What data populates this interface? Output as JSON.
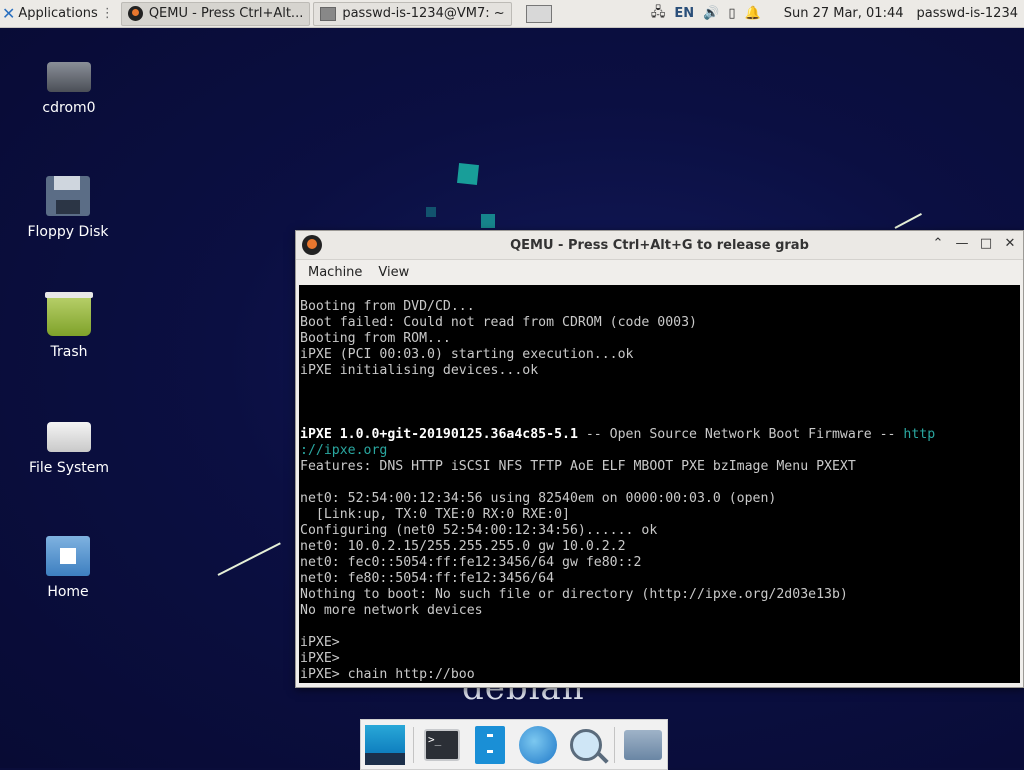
{
  "panel": {
    "applications_label": "Applications",
    "tasks": [
      {
        "label": "QEMU - Press Ctrl+Alt...",
        "icon": "qemu-icon"
      },
      {
        "label": "passwd-is-1234@VM7: ~",
        "icon": "terminal-icon"
      }
    ],
    "keyboard_layout": "EN",
    "clock": "Sun 27 Mar, 01:44",
    "user": "passwd-is-1234"
  },
  "desktop_icons": [
    {
      "label": "cdrom0",
      "icon": "optical-drive-icon"
    },
    {
      "label": "Floppy Disk",
      "icon": "floppy-disk-icon"
    },
    {
      "label": "Trash",
      "icon": "trash-icon"
    },
    {
      "label": "File System",
      "icon": "hard-drive-icon"
    },
    {
      "label": "Home",
      "icon": "home-folder-icon"
    }
  ],
  "wallpaper_text": "debian",
  "qemu": {
    "title": "QEMU - Press Ctrl+Alt+G to release grab",
    "menu": [
      "Machine",
      "View"
    ],
    "console": [
      "Booting from DVD/CD...",
      "Boot failed: Could not read from CDROM (code 0003)",
      "Booting from ROM...",
      "iPXE (PCI 00:03.0) starting execution...ok",
      "iPXE initialising devices...ok",
      "",
      "",
      "",
      "iPXE 1.0.0+git-20190125.36a4c85-5.1 -- Open Source Network Boot Firmware -- http",
      "://ipxe.org",
      "Features: DNS HTTP iSCSI NFS TFTP AoE ELF MBOOT PXE bzImage Menu PXEXT",
      "",
      "net0: 52:54:00:12:34:56 using 82540em on 0000:00:03.0 (open)",
      "  [Link:up, TX:0 TXE:0 RX:0 RXE:0]",
      "Configuring (net0 52:54:00:12:34:56)...... ok",
      "net0: 10.0.2.15/255.255.255.0 gw 10.0.2.2",
      "net0: fec0::5054:ff:fe12:3456/64 gw fe80::2",
      "net0: fe80::5054:ff:fe12:3456/64",
      "Nothing to boot: No such file or directory (http://ipxe.org/2d03e13b)",
      "No more network devices",
      "",
      "iPXE>",
      "iPXE>",
      "iPXE> chain http://boo"
    ]
  },
  "dock": [
    "show-desktop-icon",
    "terminal-icon",
    "file-manager-icon",
    "web-browser-icon",
    "app-finder-icon",
    "folder-icon"
  ]
}
